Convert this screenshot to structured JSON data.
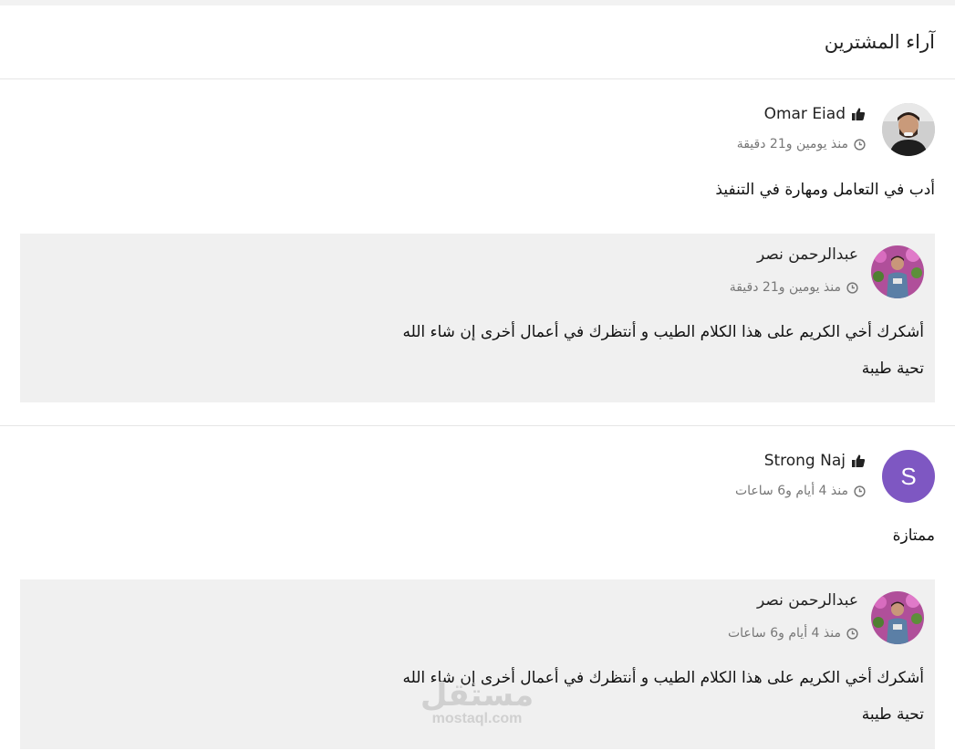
{
  "page": {
    "title": "آراء المشترين"
  },
  "reviews": [
    {
      "name": "Omar Eiad",
      "avatar_icon": "user-photo",
      "time": "منذ يومين و21 دقيقة",
      "comment": "أدب في التعامل ومهارة في التنفيذ",
      "reply": {
        "name": "عبدالرحمن نصر",
        "time": "منذ يومين و21 دقيقة",
        "line1": "أشكرك أخي الكريم على هذا الكلام الطيب و أنتظرك في أعمال أخرى إن شاء الله",
        "line2": "تحية طيبة"
      }
    },
    {
      "name": "Strong Naj",
      "avatar_letter": "S",
      "avatar_color": "#7e57c2",
      "time": "منذ 4 أيام و6 ساعات",
      "comment": "ممتازة",
      "reply": {
        "name": "عبدالرحمن نصر",
        "time": "منذ 4 أيام و6 ساعات",
        "line1": "أشكرك أخي الكريم على هذا الكلام الطيب و أنتظرك في أعمال أخرى إن شاء الله",
        "line2": "تحية طيبة"
      }
    }
  ],
  "icons": {
    "thumb": "thumbs-up-icon",
    "clock": "clock-icon"
  },
  "watermark": {
    "arabic": "مستقل",
    "latin": "mostaql.com"
  }
}
